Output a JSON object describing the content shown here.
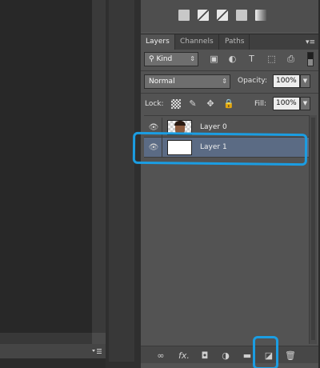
{
  "colors": {
    "panel_bg": "#535353",
    "tab_bar_bg": "#3f3f3f",
    "selected_row": "#5b6b84",
    "annotation": "#1b9de2"
  },
  "adjustments": {
    "icons": [
      "vibrance-icon",
      "hue-saturation-icon",
      "color-balance-icon",
      "black-white-icon",
      "photo-filter-icon",
      "gradient-map-icon"
    ]
  },
  "tabs": [
    {
      "label": "Layers",
      "active": true
    },
    {
      "label": "Channels",
      "active": false
    },
    {
      "label": "Paths",
      "active": false
    }
  ],
  "filter": {
    "kind_label": "Kind",
    "icons": [
      "pixel-filter-icon",
      "adjustment-filter-icon",
      "type-filter-icon",
      "shape-filter-icon",
      "smart-object-filter-icon"
    ]
  },
  "blend": {
    "mode": "Normal",
    "opacity_label": "Opacity:",
    "opacity_value": "100%"
  },
  "lock": {
    "label": "Lock:",
    "fill_label": "Fill:",
    "fill_value": "100%"
  },
  "layers": [
    {
      "name": "Layer 0",
      "visible": true,
      "selected": false,
      "thumbnail": "photo"
    },
    {
      "name": "Layer 1",
      "visible": true,
      "selected": true,
      "thumbnail": "white"
    }
  ],
  "bottom_bar": {
    "icons": [
      "link-layers-icon",
      "fx-icon",
      "layer-mask-icon",
      "adjustment-layer-icon",
      "new-group-icon",
      "new-layer-icon",
      "delete-layer-icon"
    ],
    "fx_label": "fx."
  }
}
